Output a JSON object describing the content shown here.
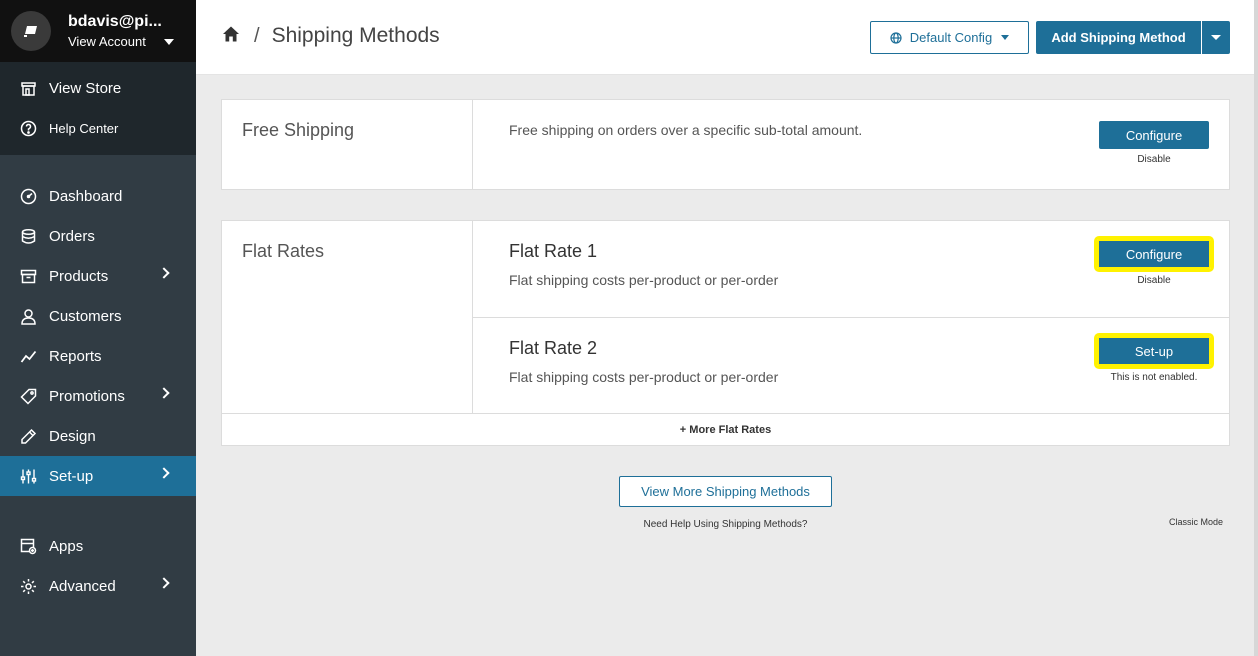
{
  "account": {
    "name": "bdavis@pi...",
    "view_label": "View Account"
  },
  "top_links": [
    {
      "label": "View Store",
      "icon": "store-icon"
    },
    {
      "label": "Help Center",
      "icon": "help-icon"
    }
  ],
  "nav": [
    {
      "label": "Dashboard",
      "icon": "dashboard-icon",
      "chevron": false
    },
    {
      "label": "Orders",
      "icon": "orders-icon",
      "chevron": false
    },
    {
      "label": "Products",
      "icon": "products-icon",
      "chevron": true
    },
    {
      "label": "Customers",
      "icon": "customers-icon",
      "chevron": false
    },
    {
      "label": "Reports",
      "icon": "reports-icon",
      "chevron": false
    },
    {
      "label": "Promotions",
      "icon": "promotions-icon",
      "chevron": true
    },
    {
      "label": "Design",
      "icon": "design-icon",
      "chevron": false
    },
    {
      "label": "Set-up",
      "icon": "setup-icon",
      "chevron": true,
      "active": true
    },
    {
      "label": "Apps",
      "icon": "apps-icon",
      "chevron": false
    },
    {
      "label": "Advanced",
      "icon": "advanced-icon",
      "chevron": true
    }
  ],
  "header": {
    "title": "Shipping Methods",
    "separator": "/",
    "config_label": "Default Config",
    "add_label": "Add Shipping Method"
  },
  "free_shipping": {
    "category": "Free Shipping",
    "description": "Free shipping on orders over a specific sub-total amount.",
    "button": "Configure",
    "sub": "Disable"
  },
  "flat_rates": {
    "category": "Flat Rates",
    "methods": [
      {
        "title": "Flat Rate 1",
        "description": "Flat shipping costs per-product or per-order",
        "button": "Configure",
        "sub": "Disable"
      },
      {
        "title": "Flat Rate 2",
        "description": "Flat shipping costs per-product or per-order",
        "button": "Set-up",
        "sub": "This is not enabled."
      }
    ],
    "more": "+ More Flat Rates"
  },
  "footer": {
    "view_more": "View More Shipping Methods",
    "help": "Need Help Using Shipping Methods?",
    "classic": "Classic Mode"
  },
  "colors": {
    "accent": "#1e6f98",
    "highlight": "#fff200",
    "sidebar": "#313c44"
  }
}
